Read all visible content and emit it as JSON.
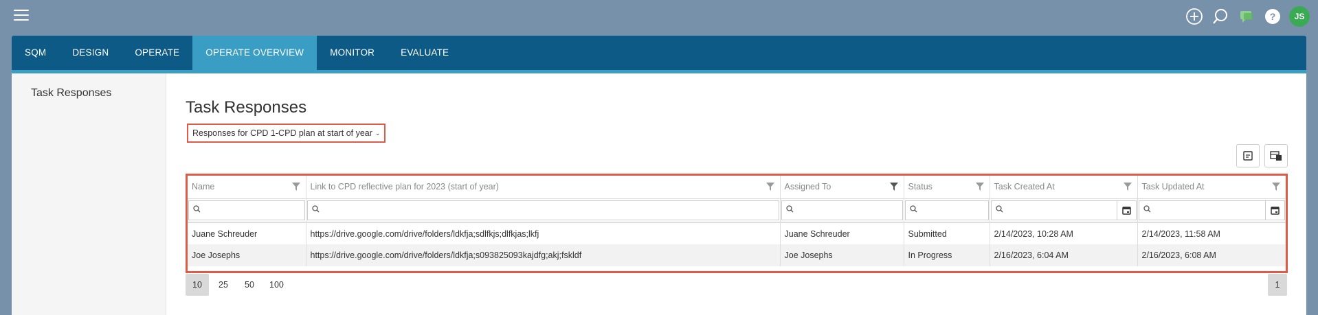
{
  "topbar": {
    "avatar_initials": "JS",
    "icons": [
      "menu-icon",
      "add-circle-icon",
      "search-icon",
      "chat-icon",
      "help-icon"
    ],
    "accent_green": "#3aaa55"
  },
  "nav": {
    "tabs": [
      {
        "label": "SQM"
      },
      {
        "label": "DESIGN"
      },
      {
        "label": "OPERATE"
      },
      {
        "label": "OPERATE OVERVIEW"
      },
      {
        "label": "MONITOR"
      },
      {
        "label": "EVALUATE"
      }
    ],
    "active": "OPERATE OVERVIEW",
    "bar_color": "#0c5a85",
    "active_color": "#3a9ec4"
  },
  "sidebar": {
    "items": [
      {
        "label": "Task Responses"
      }
    ]
  },
  "main": {
    "title": "Task Responses",
    "responses_select": "Responses for CPD 1-CPD plan at start of year",
    "highlight_color": "#e05a48"
  },
  "table": {
    "columns": [
      {
        "label": "Name"
      },
      {
        "label": "Link to CPD reflective plan for 2023 (start of year)"
      },
      {
        "label": "Assigned To"
      },
      {
        "label": "Status"
      },
      {
        "label": "Task Created At"
      },
      {
        "label": "Task Updated At"
      }
    ],
    "rows": [
      {
        "name": "Juane Schreuder",
        "link": "https://drive.google.com/drive/folders/ldkfja;sdlfkjs;dlfkjas;lkfj",
        "assigned_to": "Juane Schreuder",
        "status": "Submitted",
        "created": "2/14/2023, 10:28 AM",
        "updated": "2/14/2023, 11:58 AM"
      },
      {
        "name": "Joe Josephs",
        "link": "https://drive.google.com/drive/folders/ldkfja;s093825093kajdfg;akj;fskldf",
        "assigned_to": "Joe Josephs",
        "status": "In Progress",
        "created": "2/16/2023, 6:04 AM",
        "updated": "2/16/2023, 6:08 AM"
      }
    ]
  },
  "pager": {
    "sizes": [
      "10",
      "25",
      "50",
      "100"
    ],
    "selected_size": "10",
    "current_page": "1"
  }
}
